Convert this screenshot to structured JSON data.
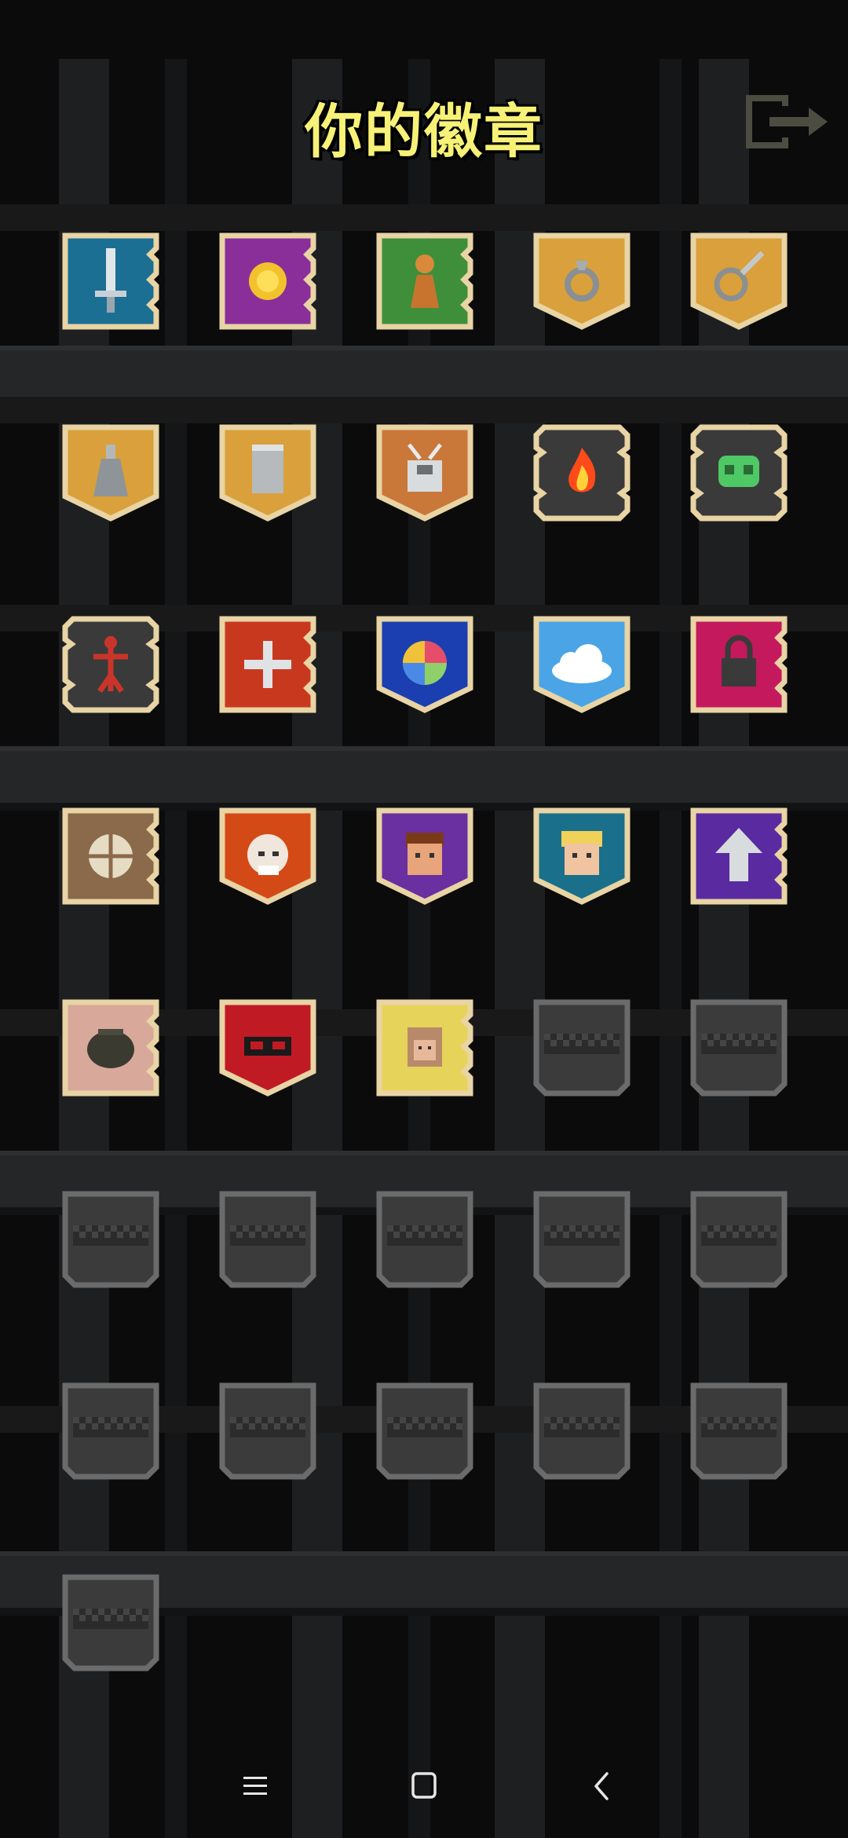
{
  "header": {
    "title": "你的徽章"
  },
  "icons": {
    "exit": "exit-door-arrow-icon"
  },
  "colors": {
    "title": "#f7f277",
    "frame_gold": "#e8d4a4",
    "frame_locked": "#6b6b6b",
    "background": "#0b0b0c"
  },
  "badges": [
    {
      "name": "sword-badge",
      "unlocked": true,
      "shape": "flag",
      "bg": "#1a6f93",
      "icon": "sword-icon"
    },
    {
      "name": "gold-coin-badge",
      "unlocked": true,
      "shape": "flag",
      "bg": "#8a2f9a",
      "icon": "coin-icon"
    },
    {
      "name": "pawn-badge",
      "unlocked": true,
      "shape": "flag",
      "bg": "#3f8f3a",
      "icon": "pawn-icon"
    },
    {
      "name": "ring-badge",
      "unlocked": true,
      "shape": "shield",
      "bg": "#d9a03b",
      "icon": "ring-icon"
    },
    {
      "name": "whistle-badge",
      "unlocked": true,
      "shape": "shield",
      "bg": "#d9a03b",
      "icon": "whistle-icon"
    },
    {
      "name": "potion-badge",
      "unlocked": true,
      "shape": "shield",
      "bg": "#d9a03b",
      "icon": "potion-icon"
    },
    {
      "name": "scroll-badge",
      "unlocked": true,
      "shape": "shield",
      "bg": "#d9a03b",
      "icon": "scroll-icon"
    },
    {
      "name": "backpack-badge",
      "unlocked": true,
      "shape": "shield",
      "bg": "#c9783a",
      "icon": "bag-icon"
    },
    {
      "name": "fire-badge",
      "unlocked": true,
      "shape": "gear",
      "bg": "#3a3a3a",
      "icon": "fire-icon"
    },
    {
      "name": "skull-badge",
      "unlocked": true,
      "shape": "gear",
      "bg": "#3a3a3a",
      "icon": "skull-icon"
    },
    {
      "name": "ankh-badge",
      "unlocked": true,
      "shape": "gear",
      "bg": "#3a3a3a",
      "icon": "ankh-icon"
    },
    {
      "name": "health-badge",
      "unlocked": true,
      "shape": "flag",
      "bg": "#c8381f",
      "icon": "cross-icon"
    },
    {
      "name": "orb-badge",
      "unlocked": true,
      "shape": "shield",
      "bg": "#1b3fb0",
      "icon": "orb-icon"
    },
    {
      "name": "cloud-badge",
      "unlocked": true,
      "shape": "shield",
      "bg": "#4aa4e6",
      "icon": "cloud-icon"
    },
    {
      "name": "lock-badge",
      "unlocked": true,
      "shape": "flag",
      "bg": "#c4195c",
      "icon": "lock-icon"
    },
    {
      "name": "wheel-badge",
      "unlocked": true,
      "shape": "flag",
      "bg": "#8a6a4a",
      "icon": "wheel-icon"
    },
    {
      "name": "old-hero-badge",
      "unlocked": true,
      "shape": "shield",
      "bg": "#d34a16",
      "icon": "old-face-icon"
    },
    {
      "name": "warrior-badge",
      "unlocked": true,
      "shape": "shield",
      "bg": "#6a2fa0",
      "icon": "face-icon"
    },
    {
      "name": "huntress-badge",
      "unlocked": true,
      "shape": "shield",
      "bg": "#1a6f8a",
      "icon": "blonde-face-icon"
    },
    {
      "name": "level-up-badge",
      "unlocked": true,
      "shape": "flag",
      "bg": "#5a2aa0",
      "icon": "arrow-up-icon"
    },
    {
      "name": "pot-badge",
      "unlocked": true,
      "shape": "flag",
      "bg": "#d8a89a",
      "icon": "pot-icon"
    },
    {
      "name": "mask-badge",
      "unlocked": true,
      "shape": "shield",
      "bg": "#c01a25",
      "icon": "mask-icon"
    },
    {
      "name": "portrait-badge",
      "unlocked": true,
      "shape": "flag",
      "bg": "#e6d35a",
      "icon": "portrait-icon"
    },
    {
      "name": "locked-badge",
      "unlocked": false
    },
    {
      "name": "locked-badge",
      "unlocked": false
    },
    {
      "name": "locked-badge",
      "unlocked": false
    },
    {
      "name": "locked-badge",
      "unlocked": false
    },
    {
      "name": "locked-badge",
      "unlocked": false
    },
    {
      "name": "locked-badge",
      "unlocked": false
    },
    {
      "name": "locked-badge",
      "unlocked": false
    },
    {
      "name": "locked-badge",
      "unlocked": false
    },
    {
      "name": "locked-badge",
      "unlocked": false
    },
    {
      "name": "locked-badge",
      "unlocked": false
    },
    {
      "name": "locked-badge",
      "unlocked": false
    },
    {
      "name": "locked-badge",
      "unlocked": false
    },
    {
      "name": "locked-badge",
      "unlocked": false
    }
  ],
  "navbar": {
    "icons": [
      "menu-icon",
      "home-square-icon",
      "back-chevron-icon"
    ]
  }
}
